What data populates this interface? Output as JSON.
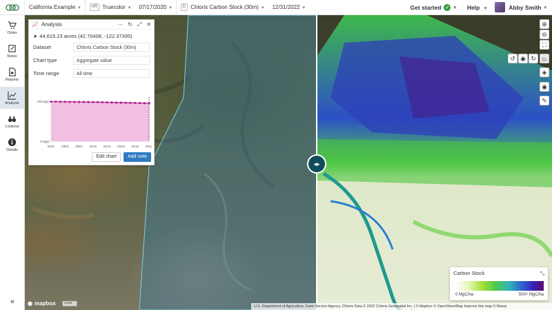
{
  "topbar": {
    "project": "California Example",
    "layer1_badge": "HR",
    "layer1_name": "Truecolor",
    "layer1_date": "07/17/2020",
    "layer2_badge": "D",
    "layer2_name": "Chloris Carbon Stock (30m)",
    "layer2_date": "12/31/2022",
    "get_started": "Get started",
    "help": "Help",
    "user_name": "Abby Smith"
  },
  "sidebar": {
    "items": [
      {
        "label": "Order",
        "icon": "cart-icon"
      },
      {
        "label": "Notes",
        "icon": "note-icon"
      },
      {
        "label": "Reports",
        "icon": "report-icon"
      },
      {
        "label": "Analysis",
        "icon": "chart-icon"
      },
      {
        "label": "Lookout",
        "icon": "binoculars-icon"
      },
      {
        "label": "Details",
        "icon": "info-icon"
      }
    ],
    "collapse": "«"
  },
  "panel": {
    "title": "Analysis",
    "acres": "44,615.23 acres (42.70408, -122.37395)",
    "dataset_label": "Dataset",
    "dataset_value": "Chloris Carbon Stock (30m)",
    "charttype_label": "Chart type",
    "charttype_value": "Aggregate value",
    "timerange_label": "Time range",
    "timerange_value": "All time",
    "edit_chart": "Edit chart",
    "add_note": "Add note"
  },
  "chart_data": {
    "type": "area",
    "x": [
      2001,
      2002,
      2003,
      2004,
      2005,
      2006,
      2007,
      2008,
      2009,
      2010,
      2011,
      2012,
      2013,
      2014,
      2015,
      2016,
      2017,
      2018,
      2019,
      2020,
      2021,
      2022
    ],
    "values": [
      3.95,
      3.95,
      3.94,
      3.94,
      3.93,
      3.93,
      3.92,
      3.92,
      3.91,
      3.9,
      3.9,
      3.89,
      3.88,
      3.87,
      3.86,
      3.85,
      3.84,
      3.83,
      3.82,
      3.81,
      3.8,
      3.8
    ],
    "x_ticks": [
      "2001",
      "2004",
      "2007",
      "2010",
      "2013",
      "2016",
      "2019",
      "2022"
    ],
    "y_ticks": [
      "0 MgC",
      "4M MgC"
    ],
    "ylim": [
      0,
      4.4
    ],
    "highlight_x": 2022,
    "color": "#b0208f",
    "fill": "#f2bfe3"
  },
  "legend": {
    "title": "Carbon Stock",
    "min_label": "0 MgC/ha",
    "max_label": "500+ MgC/ha"
  },
  "map": {
    "mapbox": "mapbox",
    "scale": "3,000'",
    "attribution": "U.S. Department of Agriculture, Farm Service Agency, Chloris Data © 2022 Chloris Geospatial Inc. | © Mapbox © OpenStreetMap Improve this map © Maxar"
  }
}
